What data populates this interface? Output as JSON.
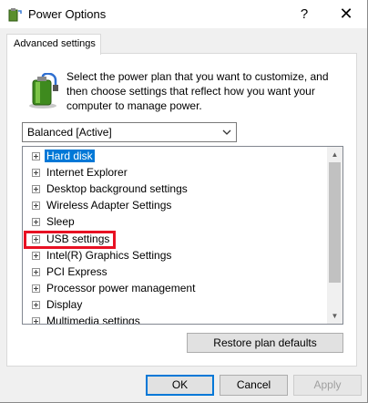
{
  "window": {
    "title": "Power Options",
    "help_glyph": "?",
    "close_glyph": "✕"
  },
  "tab": {
    "label": "Advanced settings"
  },
  "description": "Select the power plan that you want to customize, and then choose settings that reflect how you want your computer to manage power.",
  "plan_select": {
    "value": "Balanced [Active]"
  },
  "settings": {
    "items": [
      {
        "label": "Hard disk",
        "selected": true
      },
      {
        "label": "Internet Explorer"
      },
      {
        "label": "Desktop background settings"
      },
      {
        "label": "Wireless Adapter Settings"
      },
      {
        "label": "Sleep"
      },
      {
        "label": "USB settings",
        "highlighted": true
      },
      {
        "label": "Intel(R) Graphics Settings"
      },
      {
        "label": "PCI Express"
      },
      {
        "label": "Processor power management"
      },
      {
        "label": "Display"
      },
      {
        "label": "Multimedia settings"
      }
    ]
  },
  "buttons": {
    "restore": "Restore plan defaults",
    "ok": "OK",
    "cancel": "Cancel",
    "apply": "Apply"
  },
  "colors": {
    "selection": "#0078d7",
    "highlight": "#e81123"
  }
}
